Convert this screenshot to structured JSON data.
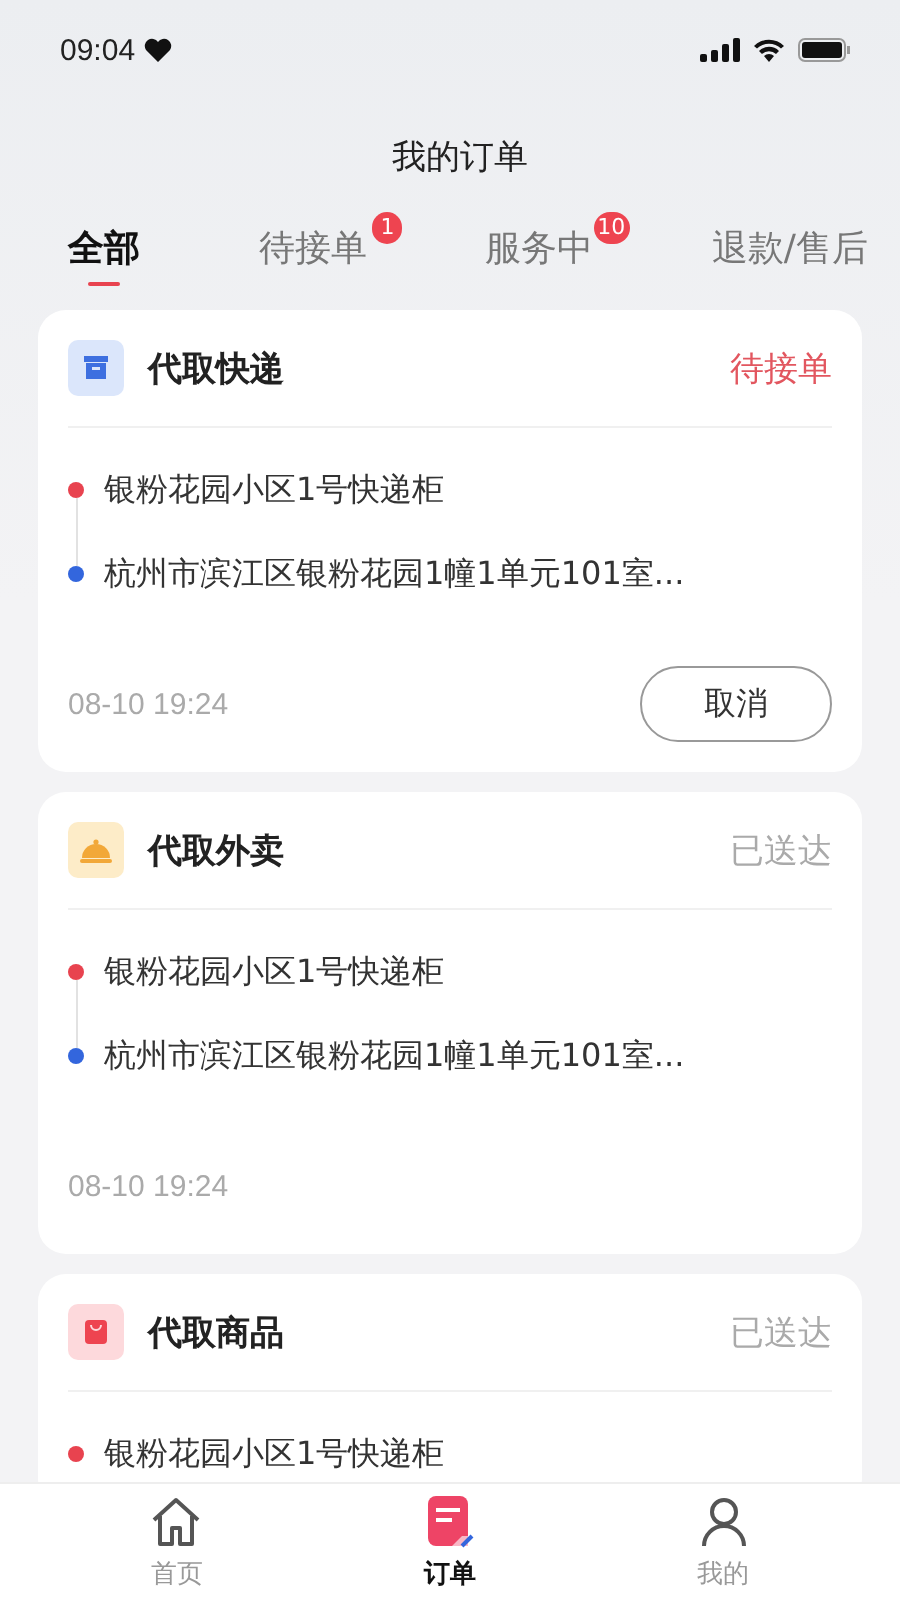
{
  "status_bar": {
    "time": "09:04"
  },
  "title": "我的订单",
  "tabs": [
    {
      "label": "全部",
      "selected": true
    },
    {
      "label": "待接单",
      "selected": false,
      "badge": "1"
    },
    {
      "label": "服务中",
      "selected": false,
      "badge": "10"
    },
    {
      "label": "退款/售后",
      "selected": false
    }
  ],
  "orders": [
    {
      "kind": "express",
      "title": "代取快递",
      "status": "待接单",
      "color": "#e2565f",
      "stops": [
        {
          "kind": "pickup",
          "text": "银粉花园小区1号快递柜"
        },
        {
          "kind": "dropoff",
          "text": "杭州市滨江区银粉花园1幢1单元101室..."
        }
      ],
      "time": "08-10 19:24",
      "action": "取消"
    },
    {
      "kind": "takeout",
      "title": "代取外卖",
      "status": "已送达",
      "color": "#aaaaaa",
      "stops": [
        {
          "kind": "pickup",
          "text": "银粉花园小区1号快递柜"
        },
        {
          "kind": "dropoff",
          "text": "杭州市滨江区银粉花园1幢1单元101室..."
        }
      ],
      "time": "08-10 19:24"
    },
    {
      "kind": "goods",
      "title": "代取商品",
      "status": "已送达",
      "color": "#aaaaaa",
      "stops": [
        {
          "kind": "pickup",
          "text": "银粉花园小区1号快递柜"
        }
      ]
    }
  ],
  "bottom_nav": [
    {
      "kind": "home",
      "label": "首页",
      "selected": false
    },
    {
      "kind": "orders",
      "label": "订单",
      "selected": true
    },
    {
      "kind": "me",
      "label": "我的",
      "selected": false
    }
  ]
}
